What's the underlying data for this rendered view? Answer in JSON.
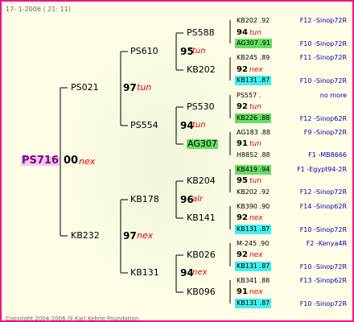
{
  "header": {
    "date_text": "17-  1-2006 ( 21: 11)"
  },
  "footer": {
    "copyright": "Copyright 2004-2006 @ Karl Kehrle Foundation."
  },
  "root": {
    "name": "PS716",
    "num": "00",
    "tag": "nex"
  },
  "gen1": [
    {
      "name": "PS021",
      "num": "97",
      "tag": "tun"
    },
    {
      "name": "KB232",
      "num": "97",
      "tag": "nex"
    }
  ],
  "gen2": [
    {
      "name": "PS610",
      "num": "95",
      "tag": "tun"
    },
    {
      "name": "PS554",
      "num": "94",
      "tag": "tun"
    },
    {
      "name": "KB178",
      "num": "96",
      "tag": "alr"
    },
    {
      "name": "KB131",
      "num": "94",
      "tag": "nex"
    }
  ],
  "gen3": [
    "PS588",
    "KB202",
    "PS530",
    "AG307",
    "KB204",
    "KB141",
    "KB026",
    "KB096"
  ],
  "gen4": [
    {
      "top": "KB202 .92",
      "num": "94",
      "tag": "tun",
      "bottom": "AG307 .91",
      "origin_top": "F12 -Sinop72R",
      "origin_bottom": "F10 -Sinop72R"
    },
    {
      "top": "KB245 .89",
      "num": "92",
      "tag": "nex",
      "bottom": "KB131 .87",
      "origin_top": "F11 -Sinop72R",
      "origin_bottom": "F10 -Sinop72R"
    },
    {
      "top": "PS557 .",
      "num": "92",
      "tag": "tun",
      "bottom": "KB226 .88",
      "origin_top": "no more",
      "origin_bottom": "F12 -Sinop62R"
    },
    {
      "top": "AG183 .88",
      "num": "91",
      "tag": "tun",
      "bottom": "H8852 .88",
      "origin_top": "F9 -Sinop72R",
      "origin_bottom": "F1 -MB8666"
    },
    {
      "top": "KB419 .94",
      "num": "95",
      "tag": "tun",
      "bottom": "KB202 .92",
      "origin_top": "F1 -Egypt94-2R",
      "origin_bottom": "F12 -Sinop72R"
    },
    {
      "top": "KB390 .90",
      "num": "92",
      "tag": "nex",
      "bottom": "KB131 .87",
      "origin_top": "F14 -Sinop62R",
      "origin_bottom": "F10 -Sinop72R"
    },
    {
      "top": "M-245 .90",
      "num": "92",
      "tag": "nex",
      "bottom": "KB131 .87",
      "origin_top": "F2 -Kenya4R",
      "origin_bottom": "F10 -Sinop72R"
    },
    {
      "top": "KB341 .88",
      "num": "91",
      "tag": "nex",
      "bottom": "KB131 .87",
      "origin_top": "F13 -Sinop62R",
      "origin_bottom": "F10 -Sinop72R"
    }
  ],
  "colors": {
    "border": "#ee1188",
    "background": "#fffde6",
    "root_highlight": "#f0c8f0",
    "green_highlight": "#66dd66",
    "cyan_highlight": "#44eeee",
    "origin_text": "#0000bb",
    "tag_text": "#dd0000"
  }
}
